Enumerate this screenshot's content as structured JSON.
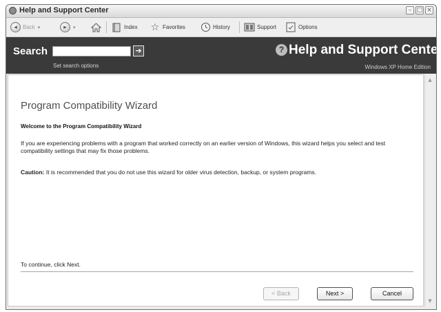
{
  "window": {
    "title": "Help and Support Center"
  },
  "toolbar": {
    "back": "Back",
    "index": "Index",
    "favorites": "Favorites",
    "history": "History",
    "support": "Support",
    "options": "Options"
  },
  "header": {
    "search_label": "Search",
    "search_value": "",
    "set_search_options": "Set search options",
    "title": "Help and Support Center",
    "edition": "Windows XP Home Edition"
  },
  "wizard": {
    "title": "Program Compatibility Wizard",
    "welcome": "Welcome to the Program Compatibility Wizard",
    "intro": "If you are experiencing problems with a program that worked correctly on an earlier version of Windows, this wizard helps you select and test compatibility settings that may fix those problems.",
    "caution_label": "Caution:",
    "caution_text": " It is recommended that you do not use this wizard for older virus detection, backup, or system programs.",
    "continue_text": "To continue, click Next.",
    "back_button": "< Back",
    "next_button": "Next >",
    "cancel_button": "Cancel"
  },
  "icons": {
    "app": "help-support-icon",
    "back": "back-arrow-icon",
    "forward": "forward-arrow-icon",
    "home": "home-icon",
    "index": "index-book-icon",
    "favorites": "favorites-star-icon",
    "history": "history-clock-icon",
    "support": "support-icon",
    "options": "options-icon",
    "search_go": "arrow-right-icon",
    "help": "question-mark-icon"
  }
}
